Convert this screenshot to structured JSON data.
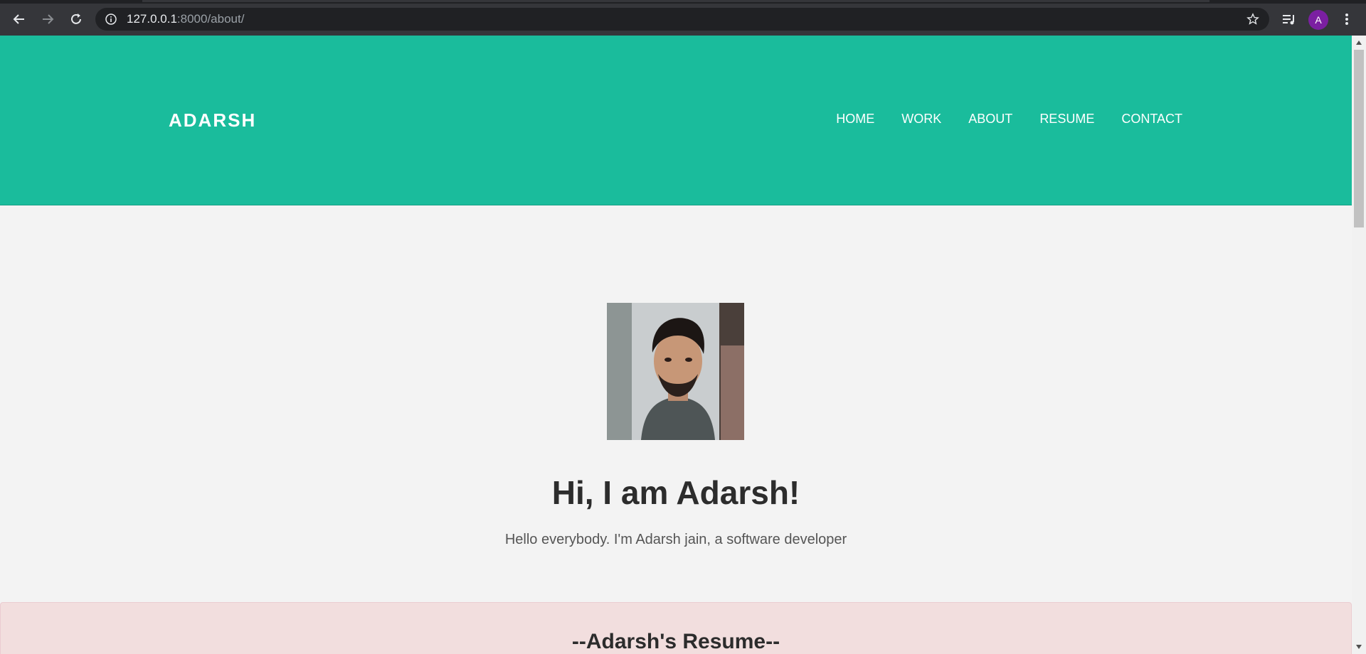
{
  "browser": {
    "url_host": "127.0.0.1",
    "url_rest": ":8000/about/",
    "profile_initial": "A"
  },
  "site": {
    "brand": "ADARSH",
    "nav": [
      "HOME",
      "WORK",
      "ABOUT",
      "RESUME",
      "CONTACT"
    ]
  },
  "hero": {
    "title": "Hi, I am Adarsh!",
    "subtitle": "Hello everybody. I'm Adarsh jain, a software developer"
  },
  "resume": {
    "title": "--Adarsh's Resume--"
  },
  "colors": {
    "header": "#1abc9c",
    "page_bg": "#f3f3f3",
    "resume_bg": "#f2dede",
    "avatar": "#7b1fa2"
  }
}
